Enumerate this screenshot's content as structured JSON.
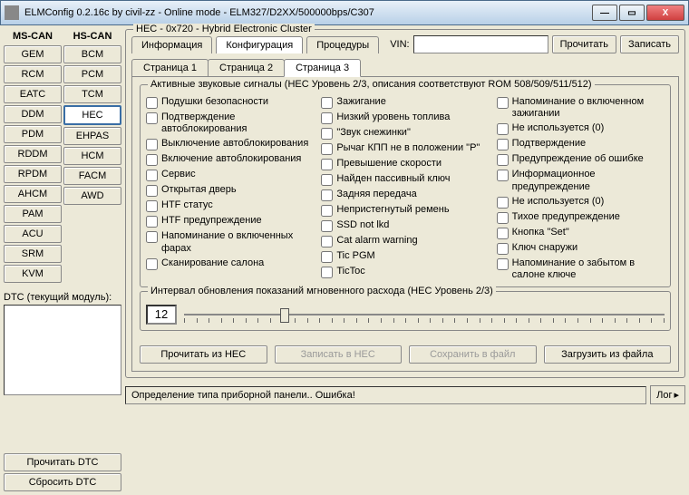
{
  "window": {
    "title": "ELMConfig 0.2.16c by civil-zz - Online mode - ELM327/D2XX/500000bps/C307"
  },
  "bus": {
    "ms_label": "MS-CAN",
    "hs_label": "HS-CAN",
    "ms": [
      "GEM",
      "RCM",
      "EATC",
      "DDM",
      "PDM",
      "RDDM",
      "RPDM",
      "AHCM",
      "PAM",
      "ACU",
      "SRM",
      "KVM"
    ],
    "hs": [
      "BCM",
      "PCM",
      "TCM",
      "HEC",
      "EHPAS",
      "HCM",
      "FACM",
      "AWD"
    ]
  },
  "dtc": {
    "label": "DTC (текущий модуль):",
    "read": "Прочитать DTC",
    "reset": "Сбросить DTC"
  },
  "module": {
    "legend": "HEC - 0x720 - Hybrid Electronic Cluster",
    "tabs": [
      "Информация",
      "Конфигурация",
      "Процедуры"
    ],
    "vin_label": "VIN:",
    "read": "Прочитать",
    "write": "Записать"
  },
  "pages": [
    "Страница 1",
    "Страница 2",
    "Страница 3"
  ],
  "signals": {
    "legend": "Активные звуковые сигналы (HEC Уровень 2/3, описания соответствуют ROM 508/509/511/512)",
    "col1": [
      "Подушки безопасности",
      "Подтверждение автоблокирования",
      "Выключение автоблокирования",
      "Включение автоблокирования",
      "Сервис",
      "Открытая дверь",
      "HTF статус",
      "HTF предупреждение",
      "Напоминание о включенных фарах",
      "Сканирование салона"
    ],
    "col2": [
      "Зажигание",
      "Низкий уровень топлива",
      "\"Звук снежинки\"",
      "Рычаг КПП не в положении \"P\"",
      "Превышение скорости",
      "Найден пассивный ключ",
      "Задняя передача",
      "Непристегнутый ремень",
      "SSD not lkd",
      "Cat alarm warning",
      "Tic PGM",
      "TicToc"
    ],
    "col3": [
      "Напоминание о включенном зажигании",
      "Не используется (0)",
      "Подтверждение",
      "Предупреждение об ошибке",
      "Информационное предупреждение",
      "Не используется (0)",
      "Тихое предупреждение",
      "Кнопка \"Set\"",
      "Ключ снаружи",
      "Напоминание о забытом в салоне ключе"
    ]
  },
  "interval": {
    "legend": "Интервал обновления показаний мгновенного расхода (HEC Уровень 2/3)",
    "value": "12"
  },
  "actions": {
    "read_hec": "Прочитать из HEC",
    "write_hec": "Записать в HEC",
    "save_file": "Сохранить в файл",
    "load_file": "Загрузить из файла"
  },
  "status": {
    "text": "Определение типа приборной панели.. Ошибка!",
    "log": "Лог"
  }
}
